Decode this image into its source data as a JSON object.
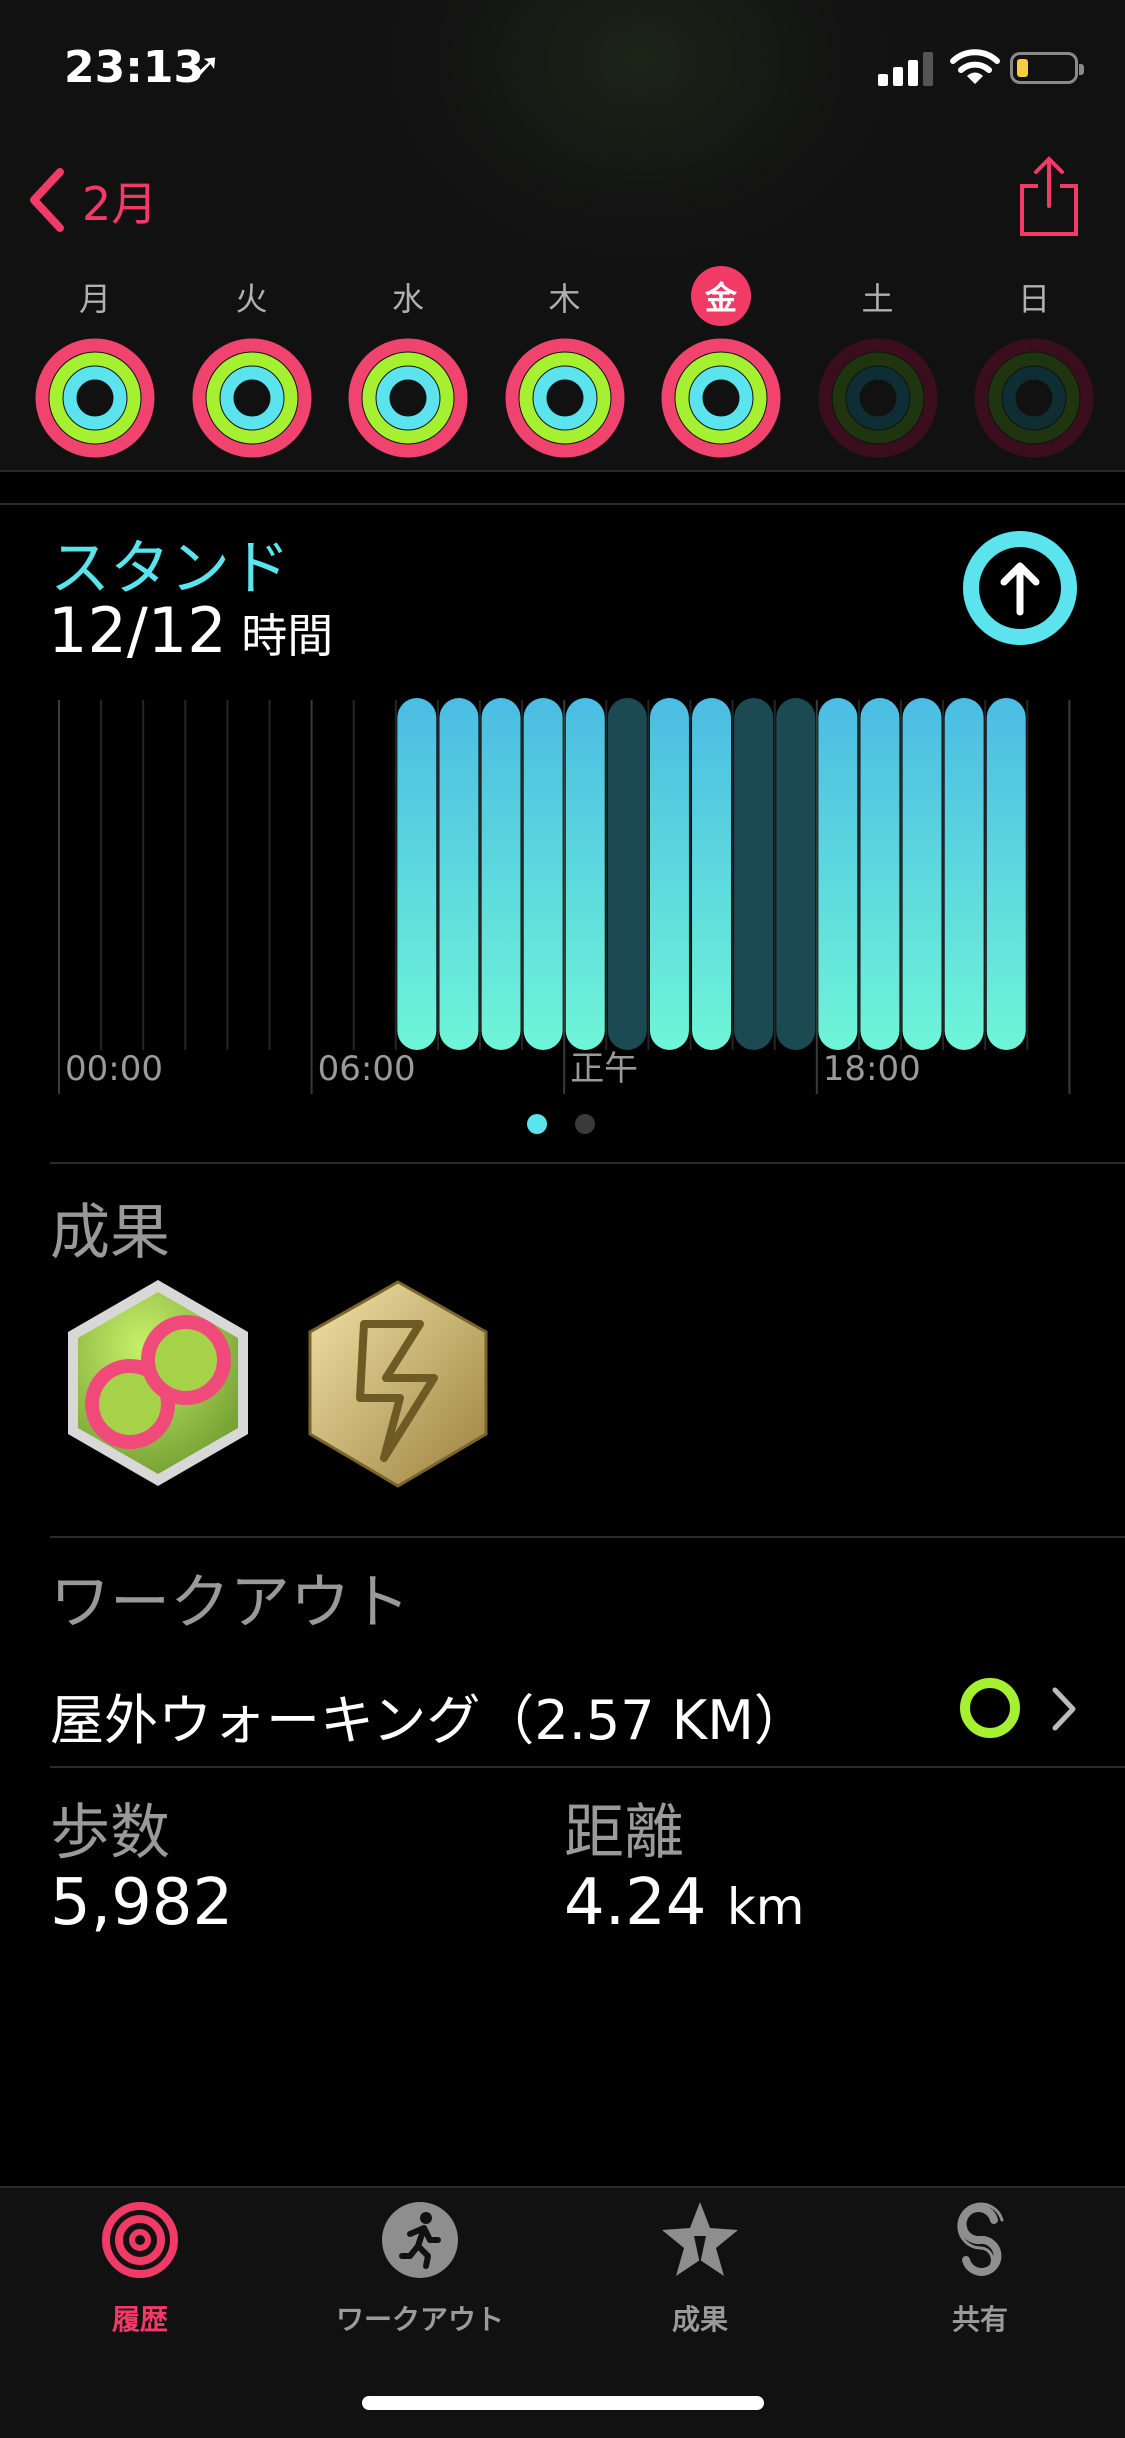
{
  "status_bar": {
    "time": "23:13",
    "location_glyph": "➚"
  },
  "nav": {
    "title": "2月",
    "accent": "#f23a66"
  },
  "week": {
    "days": [
      {
        "label": "月",
        "state": "full"
      },
      {
        "label": "火",
        "state": "full"
      },
      {
        "label": "水",
        "state": "full"
      },
      {
        "label": "木",
        "state": "full"
      },
      {
        "label": "金",
        "state": "today"
      },
      {
        "label": "土",
        "state": "empty"
      },
      {
        "label": "日",
        "state": "empty"
      }
    ]
  },
  "stand": {
    "title": "スタンド",
    "value": "12/12",
    "unit": " 時間",
    "color": "#5be4ee"
  },
  "chart_data": {
    "type": "bar",
    "title": "スタンド",
    "x_tick_labels": [
      "00:00",
      "06:00",
      "正午",
      "18:00"
    ],
    "hours": [
      0,
      1,
      2,
      3,
      4,
      5,
      6,
      7,
      8,
      9,
      10,
      11,
      12,
      13,
      14,
      15,
      16,
      17,
      18,
      19,
      20,
      21,
      22,
      23
    ],
    "stood": [
      0,
      0,
      0,
      0,
      0,
      0,
      0,
      0,
      1,
      1,
      1,
      1,
      1,
      0,
      1,
      1,
      0,
      0,
      1,
      1,
      1,
      1,
      1,
      0
    ],
    "bar_shown": [
      0,
      0,
      0,
      0,
      0,
      0,
      0,
      0,
      1,
      1,
      1,
      1,
      1,
      1,
      1,
      1,
      1,
      1,
      1,
      1,
      1,
      1,
      1,
      0
    ],
    "ylim": [
      0,
      1
    ],
    "grid": true
  },
  "pager": {
    "pages": 2,
    "current": 1
  },
  "achievements": {
    "title": "成果",
    "badges": [
      {
        "icon": "infinity-achievement-badge"
      },
      {
        "icon": "lightning-achievement-badge"
      }
    ]
  },
  "workouts": {
    "title": "ワークアウト",
    "items": [
      {
        "label": "屋外ウォーキング（2.57 KM）",
        "ring_color": "#a6f032"
      }
    ]
  },
  "stats": {
    "steps_label": "歩数",
    "steps_value": "5,982",
    "distance_label": "距離",
    "distance_value": "4.24",
    "distance_unit": "km"
  },
  "tabs": [
    {
      "label": "履歴",
      "icon": "history-rings-icon",
      "active": true
    },
    {
      "label": "ワークアウト",
      "icon": "running-figure-icon",
      "active": false
    },
    {
      "label": "成果",
      "icon": "award-star-icon",
      "active": false
    },
    {
      "label": "共有",
      "icon": "sharing-icon",
      "active": false
    }
  ]
}
